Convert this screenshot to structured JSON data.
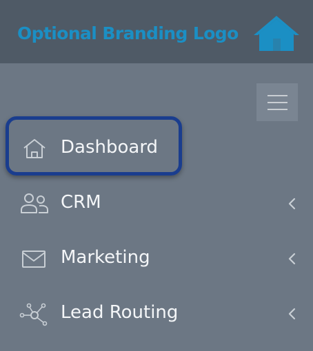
{
  "header": {
    "logo_text": "Optional Branding Logo",
    "logo_icon": "house-icon",
    "logo_color": "#1b8fc4"
  },
  "toggle": {
    "icon": "hamburger-menu-icon"
  },
  "nav": {
    "items": [
      {
        "label": "Dashboard",
        "icon": "home-icon",
        "has_submenu": false,
        "active": true
      },
      {
        "label": "CRM",
        "icon": "users-icon",
        "has_submenu": true
      },
      {
        "label": "Marketing",
        "icon": "envelope-icon",
        "has_submenu": true
      },
      {
        "label": "Lead Routing",
        "icon": "network-icon",
        "has_submenu": true
      }
    ]
  },
  "colors": {
    "sidebar_bg": "#6c7784",
    "header_bg": "#4f5a66",
    "highlight_border": "#1a3d8e",
    "text": "#f4f6f8"
  }
}
